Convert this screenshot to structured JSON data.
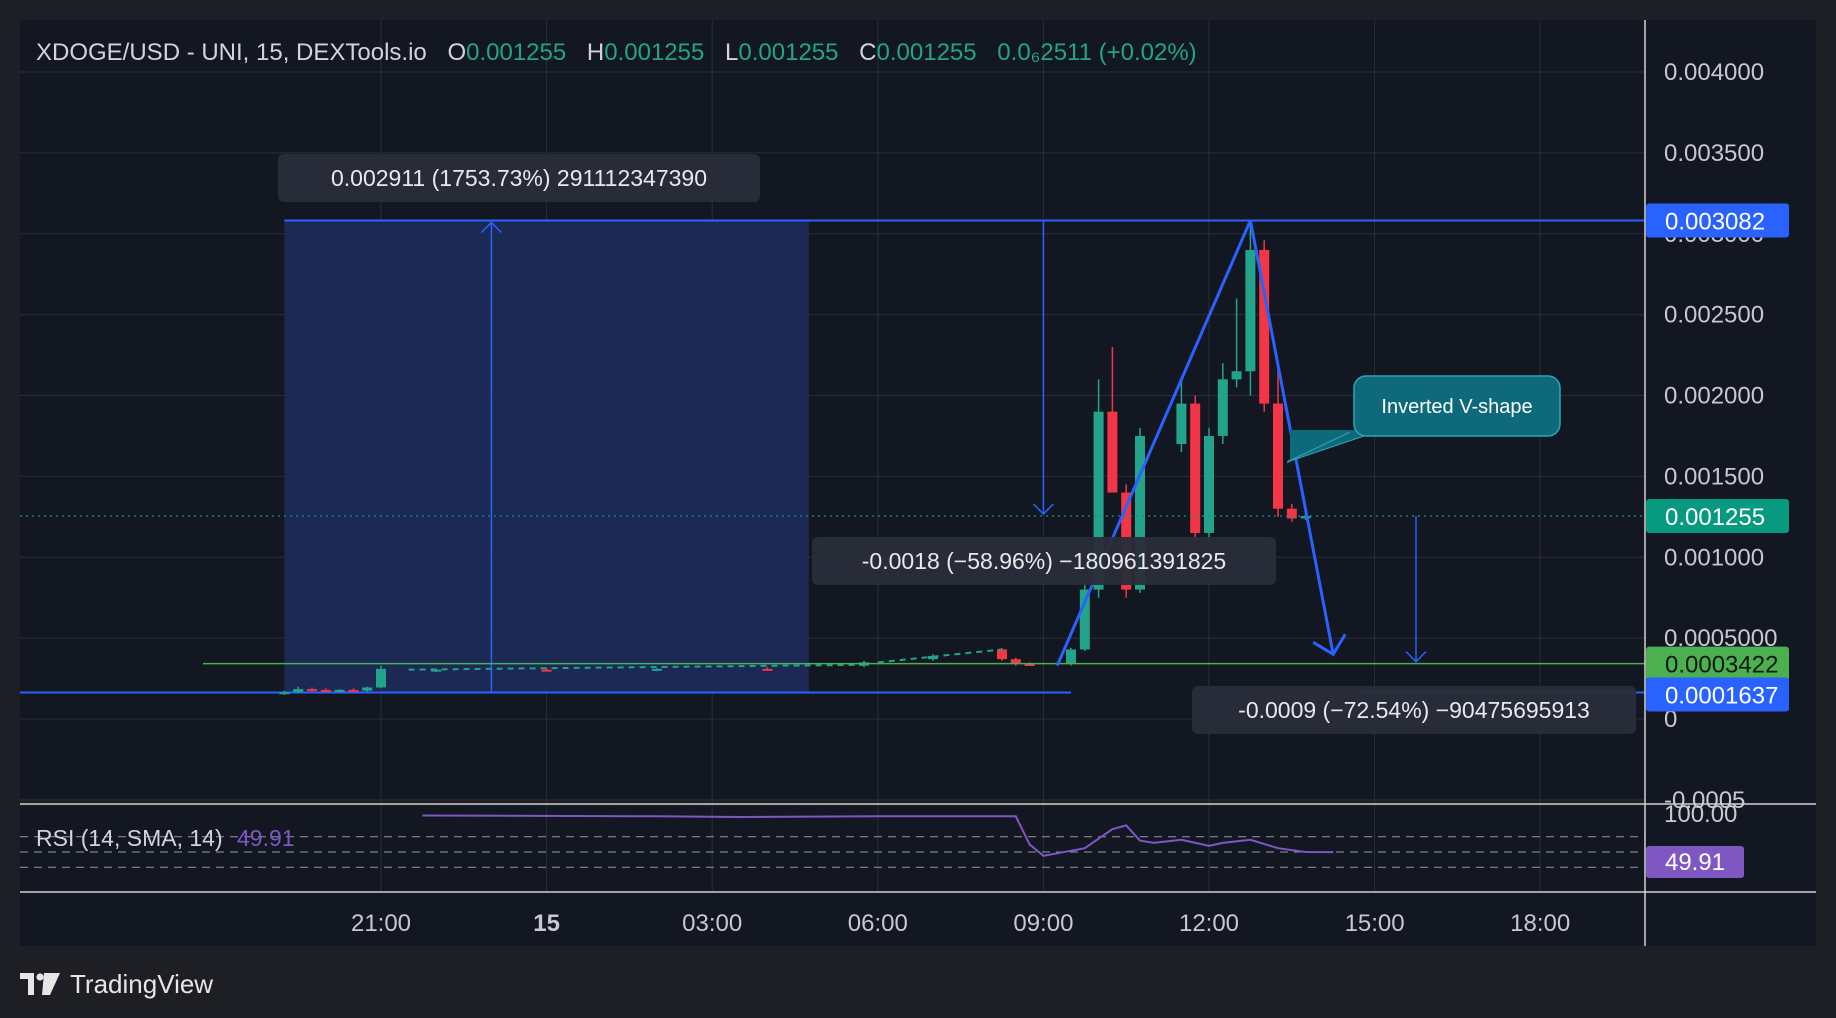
{
  "header": {
    "symbol": "XDOGE/USD - UNI, 15, DEXTools.io",
    "o_label": "O",
    "o_value": "0.001255",
    "h_label": "H",
    "h_value": "0.001255",
    "l_label": "L",
    "l_value": "0.001255",
    "c_label": "C",
    "c_value": "0.001255",
    "change": "0.0₆2511 (+0.02%)"
  },
  "colors": {
    "background": "#131722",
    "frame": "#1e1f24",
    "up": "#22a38a",
    "down": "#f23645",
    "measure_line": "#2962ff",
    "measure_fill": "#1d2b5a",
    "annotation_fill": "#0e6a7a",
    "annotation_border": "#2aa6b8",
    "rsi": "#7e57c2",
    "last_price": "#089981",
    "support": "#4caf50",
    "header_value": "#22a38a"
  },
  "y_axis": {
    "ticks": [
      "0.004000",
      "0.003500",
      "0.003000",
      "0.002500",
      "0.002000",
      "0.001500",
      "0.001000",
      "0.0005000",
      "0",
      "-0.0005"
    ],
    "badges": {
      "top_level": "0.003082",
      "last_price": "0.001255",
      "support": "0.0003422",
      "bottom_level": "0.0001637"
    }
  },
  "x_axis": {
    "ticks": [
      "21:00",
      "15",
      "03:00",
      "06:00",
      "09:00",
      "12:00",
      "15:00",
      "18:00"
    ]
  },
  "measure_labels": {
    "rise": "0.002911 (1753.73%) 291112347390",
    "drop_1": "-0.0018 (−58.96%) −180961391825",
    "drop_2": "-0.0009 (−72.54%) −90475695913"
  },
  "annotation": {
    "text": "Inverted V-shape"
  },
  "rsi": {
    "label": "RSI (14, SMA, 14)",
    "value": "49.91",
    "top_tick": "100.00"
  },
  "footer": {
    "brand": "TradingView"
  },
  "chart_data": {
    "type": "candlestick",
    "title": "XDOGE/USD - UNI, 15, DEXTools.io",
    "interval": "15",
    "ylim": [
      -0.0005,
      0.0042
    ],
    "y_ticks": [
      -0.0005,
      0,
      0.0005,
      0.001,
      0.0015,
      0.002,
      0.0025,
      0.003,
      0.0035,
      0.004
    ],
    "x_ticks": [
      "21:00",
      "15",
      "03:00",
      "06:00",
      "09:00",
      "12:00",
      "15:00",
      "18:00"
    ],
    "grid": true,
    "ohlc": {
      "open": 0.001255,
      "high": 0.001255,
      "low": 0.001255,
      "close": 0.001255,
      "change": "0.0₆2511",
      "change_pct": "+0.02%"
    },
    "price_levels": {
      "top": 0.003082,
      "last": 0.001255,
      "support": 0.0003422,
      "bottom": 0.0001637
    },
    "candles": [
      {
        "t": "19:15",
        "o": 0.00016,
        "h": 0.000175,
        "l": 0.00015,
        "c": 0.000165
      },
      {
        "t": "19:30",
        "o": 0.000165,
        "h": 0.0002,
        "l": 0.00016,
        "c": 0.000185
      },
      {
        "t": "19:45",
        "o": 0.000185,
        "h": 0.000195,
        "l": 0.00017,
        "c": 0.00018
      },
      {
        "t": "20:00",
        "o": 0.00018,
        "h": 0.00019,
        "l": 0.00017,
        "c": 0.000175
      },
      {
        "t": "20:15",
        "o": 0.000175,
        "h": 0.000185,
        "l": 0.000165,
        "c": 0.00018
      },
      {
        "t": "20:30",
        "o": 0.00018,
        "h": 0.00019,
        "l": 0.00017,
        "c": 0.000175
      },
      {
        "t": "20:45",
        "o": 0.000175,
        "h": 0.0002,
        "l": 0.00017,
        "c": 0.000195
      },
      {
        "t": "21:00",
        "o": 0.000195,
        "h": 0.00033,
        "l": 0.00019,
        "c": 0.00031
      },
      {
        "t": "22:00",
        "o": 0.0003,
        "h": 0.00031,
        "l": 0.00029,
        "c": 0.000305
      },
      {
        "t": "00:00",
        "o": 0.000305,
        "h": 0.000315,
        "l": 0.000295,
        "c": 0.0003
      },
      {
        "t": "02:00",
        "o": 0.0003,
        "h": 0.000315,
        "l": 0.000295,
        "c": 0.00031
      },
      {
        "t": "04:00",
        "o": 0.00031,
        "h": 0.00032,
        "l": 0.0003,
        "c": 0.000305
      },
      {
        "t": "05:45",
        "o": 0.00033,
        "h": 0.00036,
        "l": 0.00032,
        "c": 0.00035
      },
      {
        "t": "07:00",
        "o": 0.00037,
        "h": 0.0004,
        "l": 0.00036,
        "c": 0.00039
      },
      {
        "t": "08:15",
        "o": 0.00043,
        "h": 0.00044,
        "l": 0.00036,
        "c": 0.00037
      },
      {
        "t": "08:30",
        "o": 0.00037,
        "h": 0.00038,
        "l": 0.00033,
        "c": 0.00034
      },
      {
        "t": "08:45",
        "o": 0.00034,
        "h": 0.00035,
        "l": 0.00033,
        "c": 0.000335
      },
      {
        "t": "09:30",
        "o": 0.00034,
        "h": 0.00044,
        "l": 0.00033,
        "c": 0.00043
      },
      {
        "t": "09:45",
        "o": 0.00043,
        "h": 0.00085,
        "l": 0.00042,
        "c": 0.0008
      },
      {
        "t": "10:00",
        "o": 0.0008,
        "h": 0.0021,
        "l": 0.00075,
        "c": 0.0019
      },
      {
        "t": "10:15",
        "o": 0.0019,
        "h": 0.0023,
        "l": 0.0014,
        "c": 0.0014
      },
      {
        "t": "10:30",
        "o": 0.0014,
        "h": 0.00145,
        "l": 0.00075,
        "c": 0.0008
      },
      {
        "t": "10:45",
        "o": 0.0008,
        "h": 0.0018,
        "l": 0.00078,
        "c": 0.00175
      },
      {
        "t": "11:30",
        "o": 0.0017,
        "h": 0.0021,
        "l": 0.00165,
        "c": 0.00195
      },
      {
        "t": "11:45",
        "o": 0.00195,
        "h": 0.002,
        "l": 0.0011,
        "c": 0.00115
      },
      {
        "t": "12:00",
        "o": 0.00115,
        "h": 0.0018,
        "l": 0.0011,
        "c": 0.00175
      },
      {
        "t": "12:15",
        "o": 0.00175,
        "h": 0.0022,
        "l": 0.0017,
        "c": 0.0021
      },
      {
        "t": "12:30",
        "o": 0.0021,
        "h": 0.0026,
        "l": 0.00205,
        "c": 0.00215
      },
      {
        "t": "12:45",
        "o": 0.00215,
        "h": 0.003082,
        "l": 0.002,
        "c": 0.0029
      },
      {
        "t": "13:00",
        "o": 0.0029,
        "h": 0.00296,
        "l": 0.0019,
        "c": 0.00195
      },
      {
        "t": "13:15",
        "o": 0.00195,
        "h": 0.0022,
        "l": 0.00125,
        "c": 0.0013
      },
      {
        "t": "13:30",
        "o": 0.0013,
        "h": 0.00133,
        "l": 0.00122,
        "c": 0.00124
      },
      {
        "t": "13:45",
        "o": 0.00124,
        "h": 0.00127,
        "l": 0.00123,
        "c": 0.001255
      }
    ],
    "pattern_lines": [
      {
        "x": [
          "09:15",
          "12:45"
        ],
        "y": [
          0.00033,
          0.003082
        ]
      },
      {
        "x": [
          "12:45",
          "14:15"
        ],
        "y": [
          0.003082,
          0.0004
        ]
      }
    ],
    "measurements": [
      {
        "label": "0.002911 (1753.73%) 291112347390",
        "from": 0.0001637,
        "to": 0.003082
      },
      {
        "label": "-0.0018 (−58.96%) −180961391825",
        "from": 0.003082,
        "to": 0.001255
      },
      {
        "label": "-0.0009 (−72.54%) −90475695913",
        "from": 0.001255,
        "to": 0.0003422
      }
    ],
    "rsi_series": {
      "name": "RSI (14, SMA, 14)",
      "latest": 49.91,
      "points": [
        [
          "21:45",
          98
        ],
        [
          "02:00",
          97
        ],
        [
          "03:30",
          96
        ],
        [
          "06:00",
          97
        ],
        [
          "08:30",
          97
        ],
        [
          "08:45",
          60
        ],
        [
          "09:00",
          45
        ],
        [
          "09:45",
          55
        ],
        [
          "10:15",
          80
        ],
        [
          "10:30",
          85
        ],
        [
          "10:45",
          65
        ],
        [
          "11:00",
          62
        ],
        [
          "11:30",
          66
        ],
        [
          "12:00",
          58
        ],
        [
          "12:15",
          62
        ],
        [
          "12:45",
          66
        ],
        [
          "13:15",
          55
        ],
        [
          "13:45",
          50
        ],
        [
          "14:15",
          49.91
        ]
      ]
    }
  }
}
